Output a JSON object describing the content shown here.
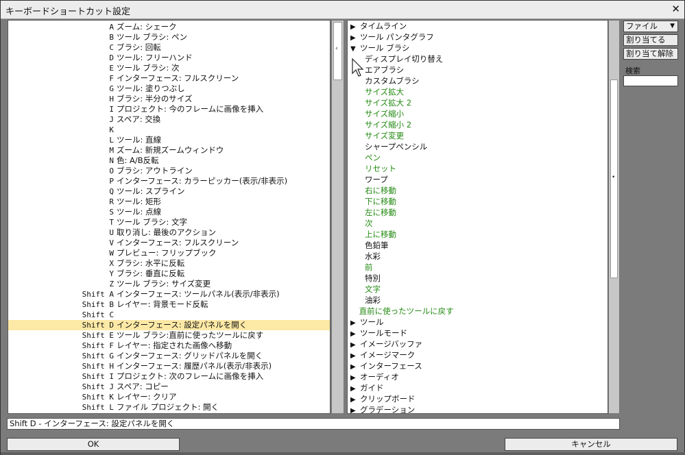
{
  "window": {
    "title": "キーボードショートカット設定",
    "close_label": "✕"
  },
  "shortcuts": [
    {
      "key": "A",
      "desc": "ズーム: シェーク"
    },
    {
      "key": "B",
      "desc": "ツール ブラシ: ペン"
    },
    {
      "key": "C",
      "desc": "ブラシ: 回転"
    },
    {
      "key": "D",
      "desc": "ツール: フリーハンド"
    },
    {
      "key": "E",
      "desc": "ツール ブラシ: 次"
    },
    {
      "key": "F",
      "desc": "インターフェース: フルスクリーン"
    },
    {
      "key": "G",
      "desc": "ツール: 塗りつぶし"
    },
    {
      "key": "H",
      "desc": "ブラシ: 半分のサイズ"
    },
    {
      "key": "I",
      "desc": "プロジェクト: 今のフレームに画像を挿入"
    },
    {
      "key": "J",
      "desc": "スペア: 交換"
    },
    {
      "key": "K",
      "desc": ""
    },
    {
      "key": "L",
      "desc": "ツール: 直線"
    },
    {
      "key": "M",
      "desc": "ズーム: 新規ズームウィンドウ"
    },
    {
      "key": "N",
      "desc": "色: A/B反転"
    },
    {
      "key": "O",
      "desc": "ブラシ: アウトライン"
    },
    {
      "key": "P",
      "desc": "インターフェース: カラーピッカー(表示/非表示)"
    },
    {
      "key": "Q",
      "desc": "ツール: スプライン"
    },
    {
      "key": "R",
      "desc": "ツール: 矩形"
    },
    {
      "key": "S",
      "desc": "ツール: 点線"
    },
    {
      "key": "T",
      "desc": "ツール ブラシ: 文字"
    },
    {
      "key": "U",
      "desc": "取り消し: 最後のアクション"
    },
    {
      "key": "V",
      "desc": "インターフェース: フルスクリーン"
    },
    {
      "key": "W",
      "desc": "プレビュー: フリップブック"
    },
    {
      "key": "X",
      "desc": "ブラシ: 水平に反転"
    },
    {
      "key": "Y",
      "desc": "ブラシ: 垂直に反転"
    },
    {
      "key": "Z",
      "desc": "ツール ブラシ: サイズ変更"
    },
    {
      "key": "Shift A",
      "desc": "インターフェース: ツールパネル(表示/非表示)"
    },
    {
      "key": "Shift B",
      "desc": "レイヤー: 背景モード反転"
    },
    {
      "key": "Shift C",
      "desc": ""
    },
    {
      "key": "Shift D",
      "desc": "インターフェース: 設定パネルを開く",
      "selected": true
    },
    {
      "key": "Shift E",
      "desc": "ツール ブラシ:直前に使ったツールに戻す"
    },
    {
      "key": "Shift F",
      "desc": "レイヤー: 指定された画像へ移動"
    },
    {
      "key": "Shift G",
      "desc": "インターフェース: グリッドパネルを開く"
    },
    {
      "key": "Shift H",
      "desc": "インターフェース: 履歴パネル(表示/非表示)"
    },
    {
      "key": "Shift I",
      "desc": "プロジェクト: 次のフレームに画像を挿入"
    },
    {
      "key": "Shift J",
      "desc": "スペア: コピー"
    },
    {
      "key": "Shift K",
      "desc": "レイヤー: クリア"
    },
    {
      "key": "Shift L",
      "desc": "ファイル プロジェクト: 開く"
    }
  ],
  "tree": [
    {
      "label": "タイムライン",
      "type": "collapsed",
      "indent": 0
    },
    {
      "label": "ツール パンタグラフ",
      "type": "collapsed",
      "indent": 0
    },
    {
      "label": "ツール ブラシ",
      "type": "expanded",
      "indent": 0
    },
    {
      "label": "ディスプレイ切り替え",
      "type": "leaf",
      "indent": 1
    },
    {
      "label": "エアブラシ",
      "type": "leaf",
      "indent": 1
    },
    {
      "label": "カスタムブラシ",
      "type": "leaf",
      "indent": 1
    },
    {
      "label": "サイズ拡大",
      "type": "leaf",
      "indent": 1,
      "assigned": true
    },
    {
      "label": "サイズ拡大 2",
      "type": "leaf",
      "indent": 1,
      "assigned": true
    },
    {
      "label": "サイズ縮小",
      "type": "leaf",
      "indent": 1,
      "assigned": true
    },
    {
      "label": "サイズ縮小 2",
      "type": "leaf",
      "indent": 1,
      "assigned": true
    },
    {
      "label": "サイズ変更",
      "type": "leaf",
      "indent": 1,
      "assigned": true
    },
    {
      "label": "シャープペンシル",
      "type": "leaf",
      "indent": 1
    },
    {
      "label": "ペン",
      "type": "leaf",
      "indent": 1,
      "assigned": true
    },
    {
      "label": "リセット",
      "type": "leaf",
      "indent": 1,
      "assigned": true
    },
    {
      "label": "ワープ",
      "type": "leaf",
      "indent": 1
    },
    {
      "label": "右に移動",
      "type": "leaf",
      "indent": 1,
      "assigned": true
    },
    {
      "label": "下に移動",
      "type": "leaf",
      "indent": 1,
      "assigned": true
    },
    {
      "label": "左に移動",
      "type": "leaf",
      "indent": 1,
      "assigned": true
    },
    {
      "label": "次",
      "type": "leaf",
      "indent": 1,
      "assigned": true
    },
    {
      "label": "上に移動",
      "type": "leaf",
      "indent": 1,
      "assigned": true
    },
    {
      "label": "色鉛筆",
      "type": "leaf",
      "indent": 1
    },
    {
      "label": "水彩",
      "type": "leaf",
      "indent": 1
    },
    {
      "label": "前",
      "type": "leaf",
      "indent": 1,
      "assigned": true
    },
    {
      "label": "特別",
      "type": "leaf",
      "indent": 1
    },
    {
      "label": "文字",
      "type": "leaf",
      "indent": 1,
      "assigned": true
    },
    {
      "label": "油彩",
      "type": "leaf",
      "indent": 1
    },
    {
      "label": "直前に使ったツールに戻す",
      "type": "leaf",
      "indent": 0.6,
      "assigned": true
    },
    {
      "label": "ツール",
      "type": "collapsed",
      "indent": 0
    },
    {
      "label": "ツールモード",
      "type": "collapsed",
      "indent": 0
    },
    {
      "label": "イメージバッファ",
      "type": "collapsed",
      "indent": 0
    },
    {
      "label": "イメージマーク",
      "type": "collapsed",
      "indent": 0
    },
    {
      "label": "インターフェース",
      "type": "collapsed",
      "indent": 0
    },
    {
      "label": "オーディオ",
      "type": "collapsed",
      "indent": 0
    },
    {
      "label": "ガイド",
      "type": "collapsed",
      "indent": 0
    },
    {
      "label": "クリップボード",
      "type": "collapsed",
      "indent": 0
    },
    {
      "label": "グラデーション",
      "type": "collapsed",
      "indent": 0
    }
  ],
  "sidebar": {
    "file_menu": "ファイル",
    "assign": "割り当てる",
    "unassign": "割り当て解除",
    "search_label": "検索",
    "search_value": ""
  },
  "status_text": "Shift D - インターフェース: 設定パネルを開く",
  "buttons": {
    "ok": "OK",
    "cancel": "キャンセル"
  },
  "colors": {
    "assigned_text": "#238a12",
    "selected_row": "#fde9a6"
  }
}
